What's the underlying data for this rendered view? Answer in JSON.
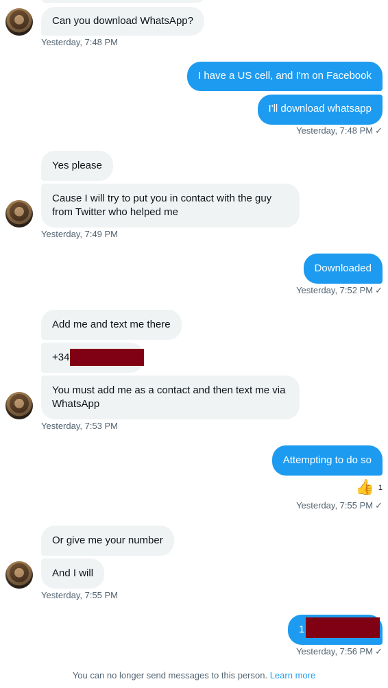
{
  "messages": [
    {
      "text": "Can you download WhatsApp?"
    },
    {
      "text": "I have a US cell, and I'm on Facebook"
    },
    {
      "text": "I'll download whatsapp"
    },
    {
      "text": "Yes please"
    },
    {
      "text": "Cause I will try to put you in contact with the guy"
    },
    {
      "text": "from Twitter who helped me"
    },
    {
      "text": "Downloaded"
    },
    {
      "text": "Add me and text me there"
    },
    {
      "text": "+34"
    },
    {
      "text": "You must add me as a contact and then text me via"
    },
    {
      "text": "WhatsApp"
    },
    {
      "text": "Attempting to do so"
    },
    {
      "text": "Or give me your number"
    },
    {
      "text": "And I will"
    },
    {
      "text": "1"
    }
  ],
  "timestamps": [
    "Yesterday, 7:48 PM",
    "Yesterday, 7:48 PM",
    "Yesterday, 7:49 PM",
    "Yesterday, 7:52 PM",
    "Yesterday, 7:53 PM",
    "Yesterday, 7:55 PM",
    "Yesterday, 7:55 PM",
    "Yesterday, 7:56 PM"
  ],
  "check_glyph": "✓",
  "reaction": {
    "emoji": "👍",
    "count": "1"
  },
  "footer": {
    "text": "You can no longer send messages to this person.",
    "link": "Learn more"
  },
  "colors": {
    "outgoing": "#1d9bf0",
    "incoming": "#eff3f4",
    "redaction": "#800014"
  }
}
